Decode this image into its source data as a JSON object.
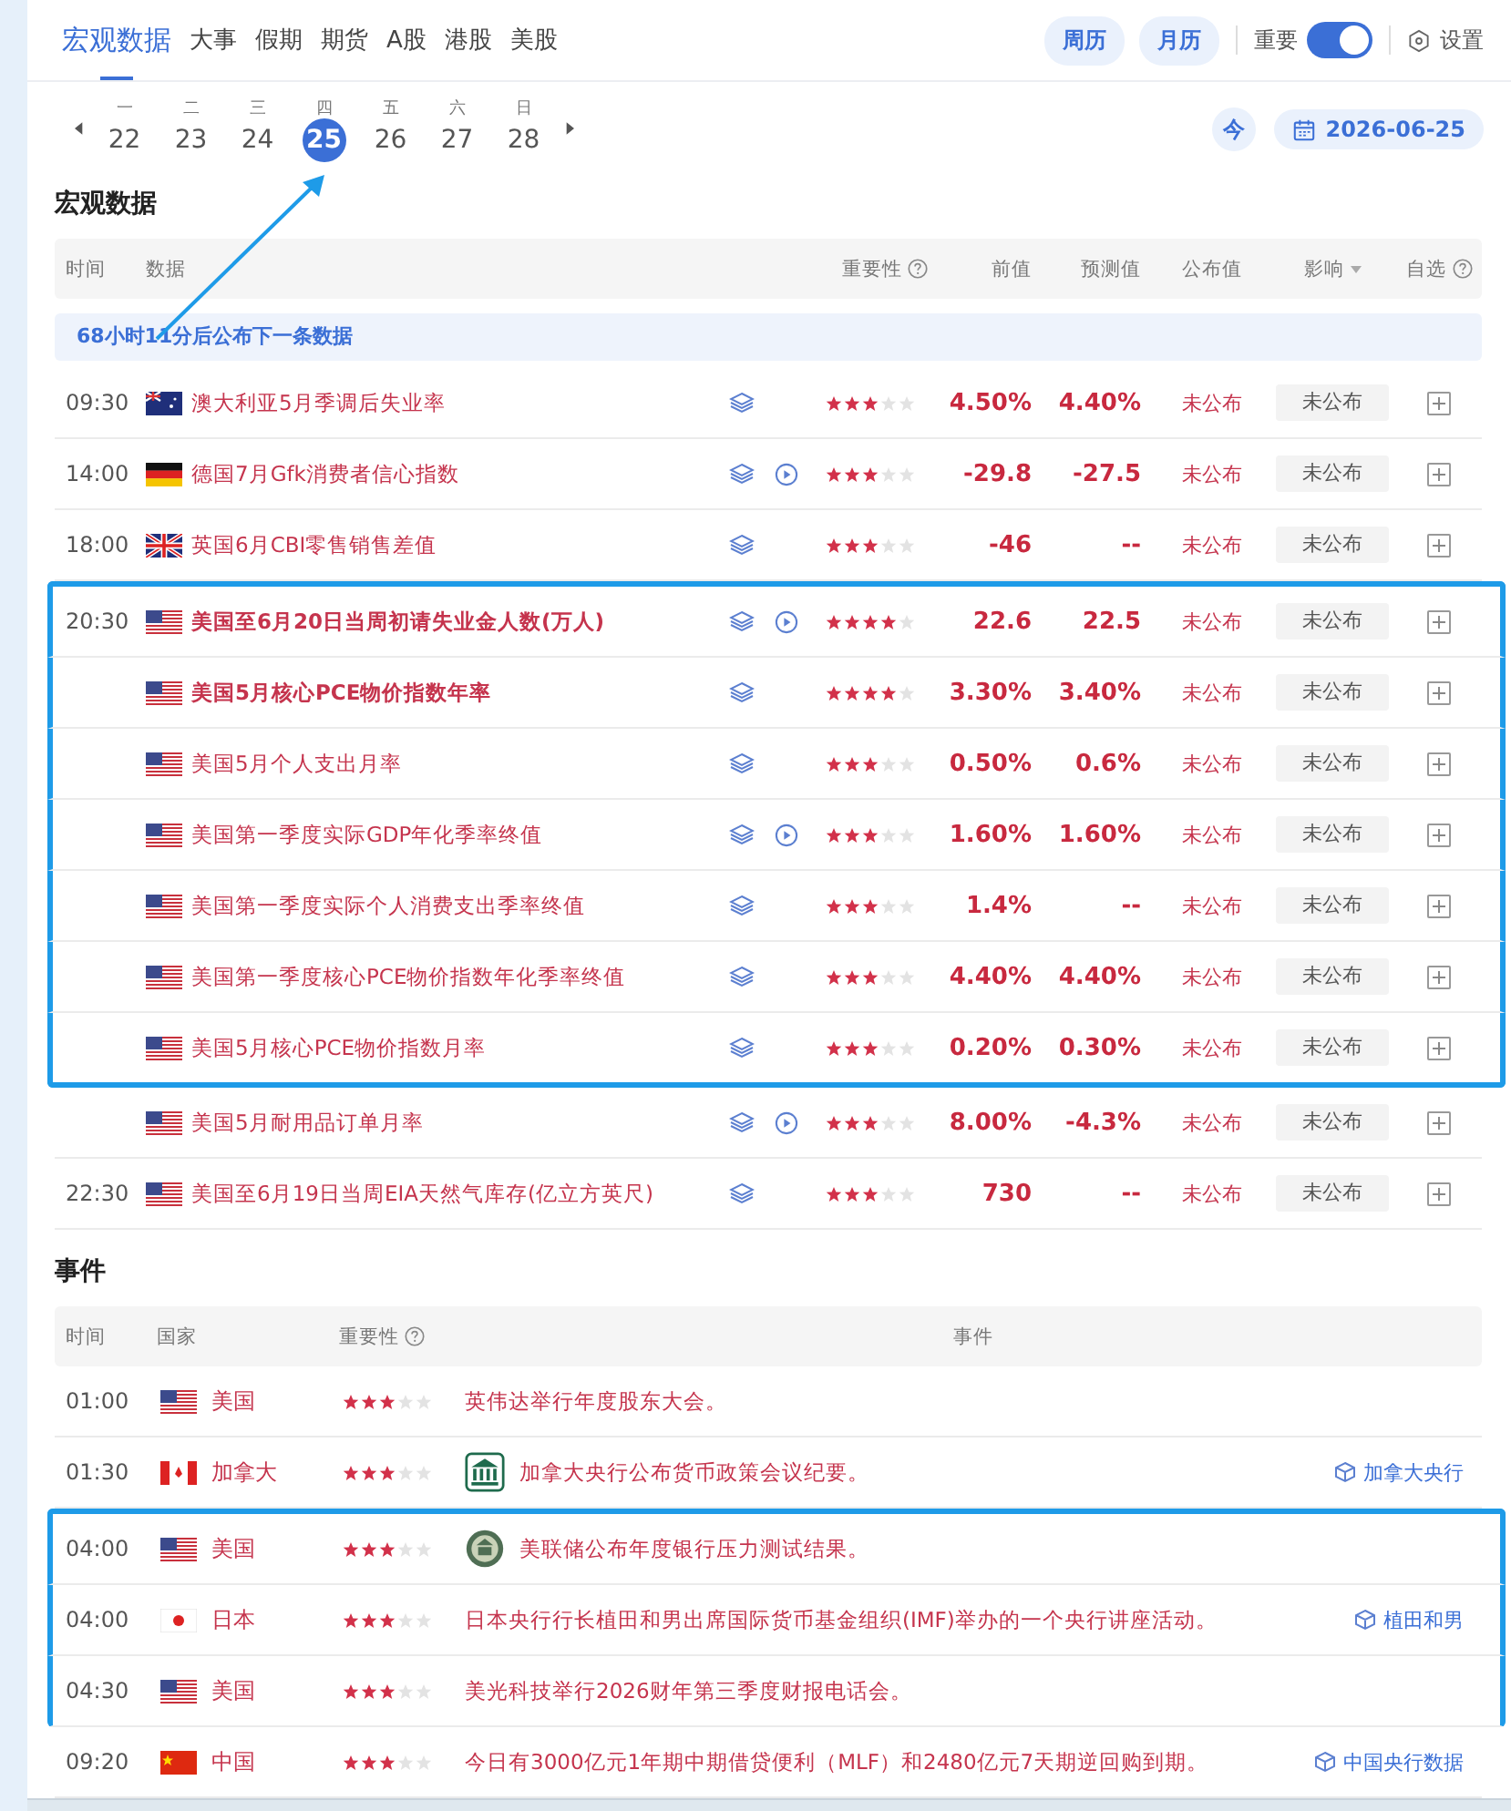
{
  "tabs": [
    {
      "label": "宏观数据",
      "selected": true
    },
    {
      "label": "大事",
      "selected": false
    },
    {
      "label": "假期",
      "selected": false
    },
    {
      "label": "期货",
      "selected": false
    },
    {
      "label": "A股",
      "selected": false
    },
    {
      "label": "港股",
      "selected": false
    },
    {
      "label": "美股",
      "selected": false
    }
  ],
  "view_buttons": [
    "周历",
    "月历"
  ],
  "toggle": {
    "label": "重要",
    "on": true
  },
  "settings": "设置",
  "week": {
    "days": [
      {
        "weekday": "一",
        "date": "22",
        "selected": false
      },
      {
        "weekday": "二",
        "date": "23",
        "selected": false
      },
      {
        "weekday": "三",
        "date": "24",
        "selected": false
      },
      {
        "weekday": "四",
        "date": "25",
        "selected": true
      },
      {
        "weekday": "五",
        "date": "26",
        "selected": false
      },
      {
        "weekday": "六",
        "date": "27",
        "selected": false
      },
      {
        "weekday": "日",
        "date": "28",
        "selected": false
      }
    ],
    "today_button": "今",
    "date": "2026-06-25"
  },
  "macro": {
    "title": "宏观数据",
    "columns": [
      {
        "label": "时间",
        "help": false,
        "sort": false
      },
      {
        "label": "数据",
        "help": false,
        "sort": false
      },
      {
        "label": "重要性",
        "help": true,
        "sort": false
      },
      {
        "label": "前值",
        "help": false,
        "sort": false
      },
      {
        "label": "预测值",
        "help": false,
        "sort": false
      },
      {
        "label": "公布值",
        "help": false,
        "sort": false
      },
      {
        "label": "影响",
        "help": false,
        "sort": true
      },
      {
        "label": "自选",
        "help": true,
        "sort": false
      }
    ],
    "notice": "68小时11分后公布下一条数据",
    "rows": [
      {
        "time": "09:30",
        "kind": "australia",
        "name": "澳大利亚5月季调后失业率",
        "bold": false,
        "video": false,
        "stars": 3,
        "previous": "4.50%",
        "forecast": "4.40%",
        "actual": "未公布",
        "impact": "未公布",
        "highlighted": false
      },
      {
        "time": "14:00",
        "kind": "germany",
        "name": "德国7月Gfk消费者信心指数",
        "bold": false,
        "video": true,
        "stars": 3,
        "previous": "-29.8",
        "forecast": "-27.5",
        "actual": "未公布",
        "impact": "未公布",
        "highlighted": false
      },
      {
        "time": "18:00",
        "kind": "uk",
        "name": "英国6月CBI零售销售差值",
        "bold": false,
        "video": false,
        "stars": 3,
        "previous": "-46",
        "forecast": "--",
        "actual": "未公布",
        "impact": "未公布",
        "highlighted": false
      },
      {
        "time": "20:30",
        "kind": "usa",
        "name": "美国至6月20日当周初请失业金人数(万人)",
        "bold": true,
        "video": true,
        "stars": 4,
        "previous": "22.6",
        "forecast": "22.5",
        "actual": "未公布",
        "impact": "未公布",
        "highlighted": true
      },
      {
        "kind": "usa",
        "name": "美国5月核心PCE物价指数年率",
        "bold": true,
        "video": false,
        "stars": 4,
        "previous": "3.30%",
        "forecast": "3.40%",
        "actual": "未公布",
        "impact": "未公布",
        "highlighted": true
      },
      {
        "kind": "usa",
        "name": "美国5月个人支出月率",
        "bold": false,
        "video": false,
        "stars": 3,
        "previous": "0.50%",
        "forecast": "0.6%",
        "actual": "未公布",
        "impact": "未公布",
        "highlighted": true
      },
      {
        "kind": "usa",
        "name": "美国第一季度实际GDP年化季率终值",
        "bold": false,
        "video": true,
        "stars": 3,
        "previous": "1.60%",
        "forecast": "1.60%",
        "actual": "未公布",
        "impact": "未公布",
        "highlighted": true
      },
      {
        "kind": "usa",
        "name": "美国第一季度实际个人消费支出季率终值",
        "bold": false,
        "video": false,
        "stars": 3,
        "previous": "1.4%",
        "forecast": "--",
        "actual": "未公布",
        "impact": "未公布",
        "highlighted": true
      },
      {
        "kind": "usa",
        "name": "美国第一季度核心PCE物价指数年化季率终值",
        "bold": false,
        "video": false,
        "stars": 3,
        "previous": "4.40%",
        "forecast": "4.40%",
        "actual": "未公布",
        "impact": "未公布",
        "highlighted": true
      },
      {
        "kind": "usa",
        "name": "美国5月核心PCE物价指数月率",
        "bold": false,
        "video": false,
        "stars": 3,
        "previous": "0.20%",
        "forecast": "0.30%",
        "actual": "未公布",
        "impact": "未公布",
        "highlighted": true
      },
      {
        "kind": "usa",
        "name": "美国5月耐用品订单月率",
        "bold": false,
        "video": true,
        "stars": 3,
        "previous": "8.00%",
        "forecast": "-4.3%",
        "actual": "未公布",
        "impact": "未公布",
        "highlighted": false
      },
      {
        "time": "22:30",
        "kind": "usa",
        "name": "美国至6月19日当周EIA天然气库存(亿立方英尺)",
        "bold": false,
        "video": false,
        "stars": 3,
        "previous": "730",
        "forecast": "--",
        "actual": "未公布",
        "impact": "未公布",
        "highlighted": false
      }
    ]
  },
  "events": {
    "title": "事件",
    "columns": [
      {
        "label": "时间",
        "help": false
      },
      {
        "label": "国家",
        "help": false
      },
      {
        "label": "重要性",
        "help": true
      },
      {
        "label": "事件",
        "help": false
      }
    ],
    "rows": [
      {
        "time": "01:00",
        "kind": "usa",
        "country": "美国",
        "stars": 3,
        "text": "英伟达举行年度股东大会。",
        "highlighted": false
      },
      {
        "time": "01:30",
        "kind": "canada",
        "country": "加拿大",
        "stars": 3,
        "logo": {
          "kind": "bank"
        },
        "text": "加拿大央行公布货币政策会议纪要。",
        "link": "加拿大央行",
        "highlighted": false
      },
      {
        "time": "04:00",
        "kind": "usa",
        "country": "美国",
        "stars": 3,
        "logo": {
          "kind": "seal"
        },
        "text": "美联储公布年度银行压力测试结果。",
        "highlighted": true
      },
      {
        "time": "04:00",
        "kind": "japan",
        "country": "日本",
        "stars": 3,
        "text": "日本央行行长植田和男出席国际货币基金组织(IMF)举办的一个央行讲座活动。",
        "link": "植田和男",
        "highlighted": true
      },
      {
        "time": "04:30",
        "kind": "usa",
        "country": "美国",
        "stars": 3,
        "text": "美光科技举行2026财年第三季度财报电话会。",
        "highlighted": true
      },
      {
        "time": "09:20",
        "kind": "china",
        "country": "中国",
        "stars": 3,
        "text": "今日有3000亿元1年期中期借贷便利（MLF）和2480亿元7天期逆回购到期。",
        "link": "中国央行数据",
        "highlighted": false
      }
    ]
  }
}
